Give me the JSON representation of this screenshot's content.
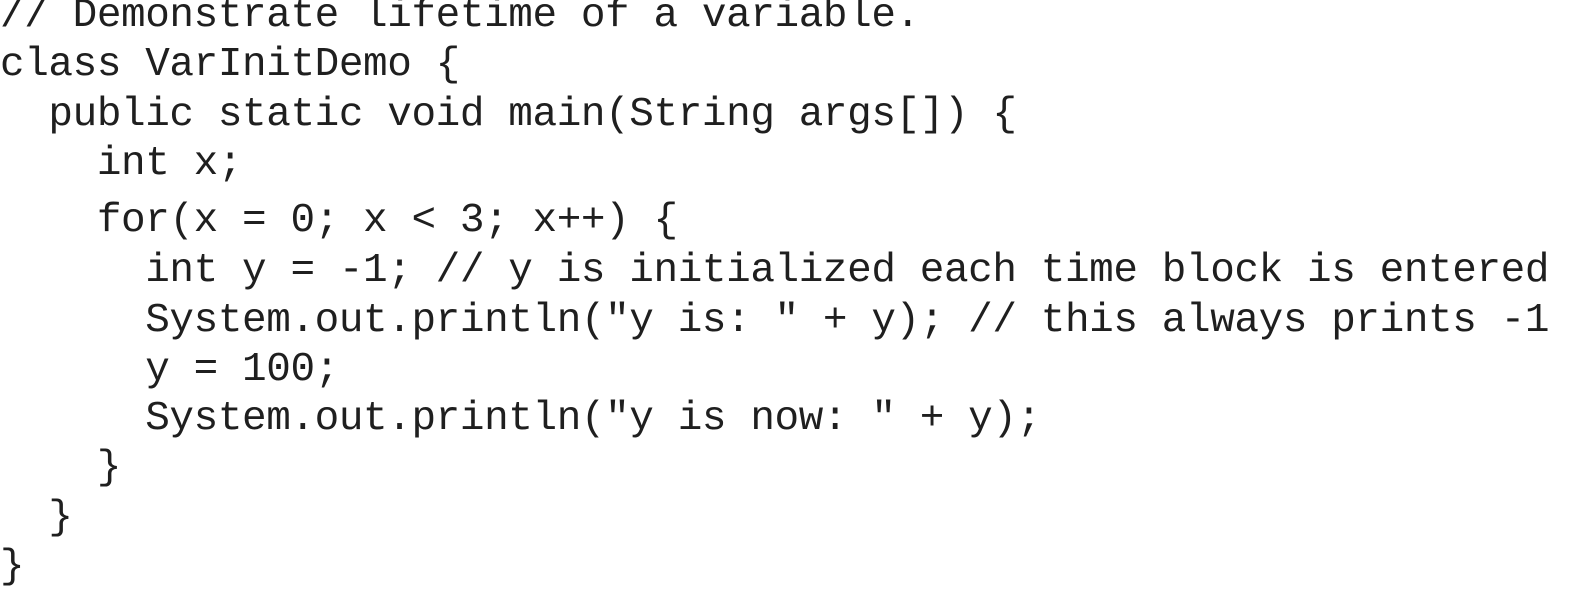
{
  "code": {
    "lines": [
      "// Demonstrate lifetime of a variable.",
      "class VarInitDemo {",
      "  public static void main(String args[]) {",
      "    int x;",
      "    for(x = 0; x < 3; x++) {",
      "      int y = -1; // y is initialized each time block is entered",
      "      System.out.println(\"y is: \" + y); // this always prints -1",
      "      y = 100;",
      "      System.out.println(\"y is now: \" + y);",
      "    }",
      "  }",
      "}"
    ]
  }
}
